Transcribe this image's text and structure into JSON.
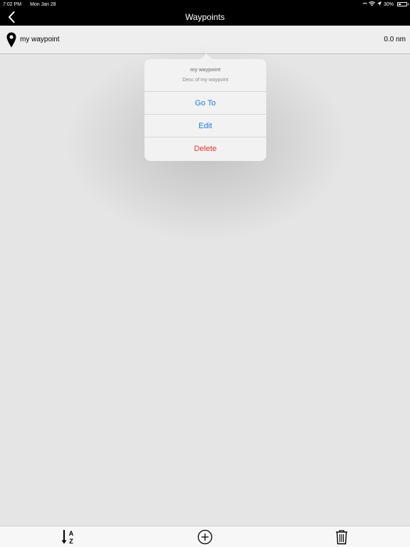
{
  "status_bar": {
    "time": "7:02 PM",
    "date": "Mon Jan 28",
    "battery_text": "30%",
    "battery_level": 0.3
  },
  "nav": {
    "title": "Waypoints",
    "back_icon": "chevron-left-icon"
  },
  "waypoints": [
    {
      "name": "my waypoint",
      "distance": "0.0 nm",
      "icon": "map-pin-icon"
    }
  ],
  "popover": {
    "title": "my waypoint",
    "description": "Desc of my waypoint",
    "actions": {
      "goto": "Go To",
      "edit": "Edit",
      "delete": "Delete"
    }
  },
  "toolbar": {
    "sort_icon": "sort-az-icon",
    "add_icon": "add-circle-icon",
    "trash_icon": "trash-icon"
  },
  "colors": {
    "accent_blue": "#1a7bd9",
    "destructive_red": "#e0362d",
    "background": "#e5e5e5",
    "nav_background": "#000000"
  }
}
